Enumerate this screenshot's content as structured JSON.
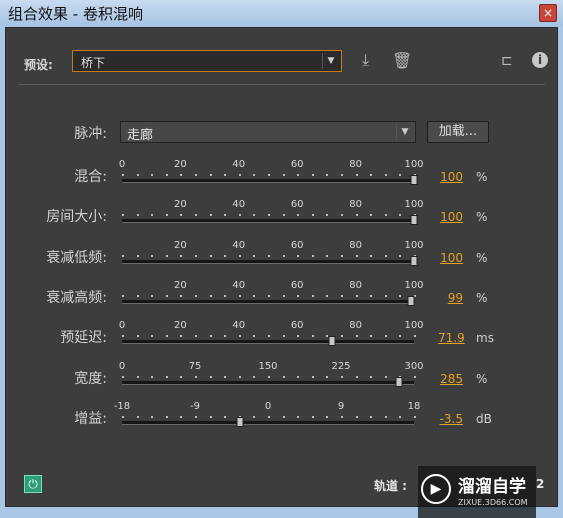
{
  "window": {
    "title": "组合效果 - 卷积混响",
    "close": "×"
  },
  "preset": {
    "label": "预设:",
    "value": "桥下",
    "save_icon": "download-icon",
    "delete_icon": "trash-icon"
  },
  "header_icons": {
    "routing": "routing-icon",
    "info": "info-icon"
  },
  "impulse": {
    "label": "脉冲:",
    "value": "走廊",
    "load_label": "加载..."
  },
  "sliders": [
    {
      "label": "混合:",
      "ticks": [
        "0",
        "20",
        "40",
        "60",
        "80",
        "100"
      ],
      "tick_positions": [
        0,
        0.2,
        0.4,
        0.6,
        0.8,
        1.0
      ],
      "fraction": 1.0,
      "value": "100",
      "unit": "%"
    },
    {
      "label": "房间大小:",
      "ticks": [
        "20",
        "40",
        "60",
        "80",
        "100"
      ],
      "tick_positions": [
        0.2,
        0.4,
        0.6,
        0.8,
        1.0
      ],
      "fraction": 1.0,
      "value": "100",
      "unit": "%"
    },
    {
      "label": "衰减低频:",
      "ticks": [
        "20",
        "40",
        "60",
        "80",
        "100"
      ],
      "tick_positions": [
        0.2,
        0.4,
        0.6,
        0.8,
        1.0
      ],
      "fraction": 1.0,
      "value": "100",
      "unit": "%"
    },
    {
      "label": "衰减高频:",
      "ticks": [
        "20",
        "40",
        "60",
        "80",
        "100"
      ],
      "tick_positions": [
        0.2,
        0.4,
        0.6,
        0.8,
        1.0
      ],
      "fraction": 0.99,
      "value": "99",
      "unit": "%"
    },
    {
      "label": "预延迟:",
      "ticks": [
        "0",
        "20",
        "40",
        "60",
        "80",
        "100"
      ],
      "tick_positions": [
        0,
        0.2,
        0.4,
        0.6,
        0.8,
        1.0
      ],
      "fraction": 0.719,
      "value": "71.9",
      "unit": "ms"
    },
    {
      "label": "宽度:",
      "ticks": [
        "0",
        "75",
        "150",
        "225",
        "300"
      ],
      "tick_positions": [
        0,
        0.25,
        0.5,
        0.75,
        1.0
      ],
      "fraction": 0.95,
      "value": "285",
      "unit": "%"
    },
    {
      "label": "增益:",
      "ticks": [
        "-18",
        "-9",
        "0",
        "9",
        "18"
      ],
      "tick_positions": [
        0,
        0.25,
        0.5,
        0.75,
        1.0
      ],
      "fraction": 0.403,
      "value": "-3.5",
      "unit": "dB"
    }
  ],
  "footer": {
    "track_label": "轨道 :",
    "track_trail": "2",
    "power_icon": "power-icon"
  },
  "watermark": {
    "title": "溜溜自学",
    "subtitle": "ZIXUE.3D66.COM",
    "logo_icon": "play-logo-icon"
  }
}
